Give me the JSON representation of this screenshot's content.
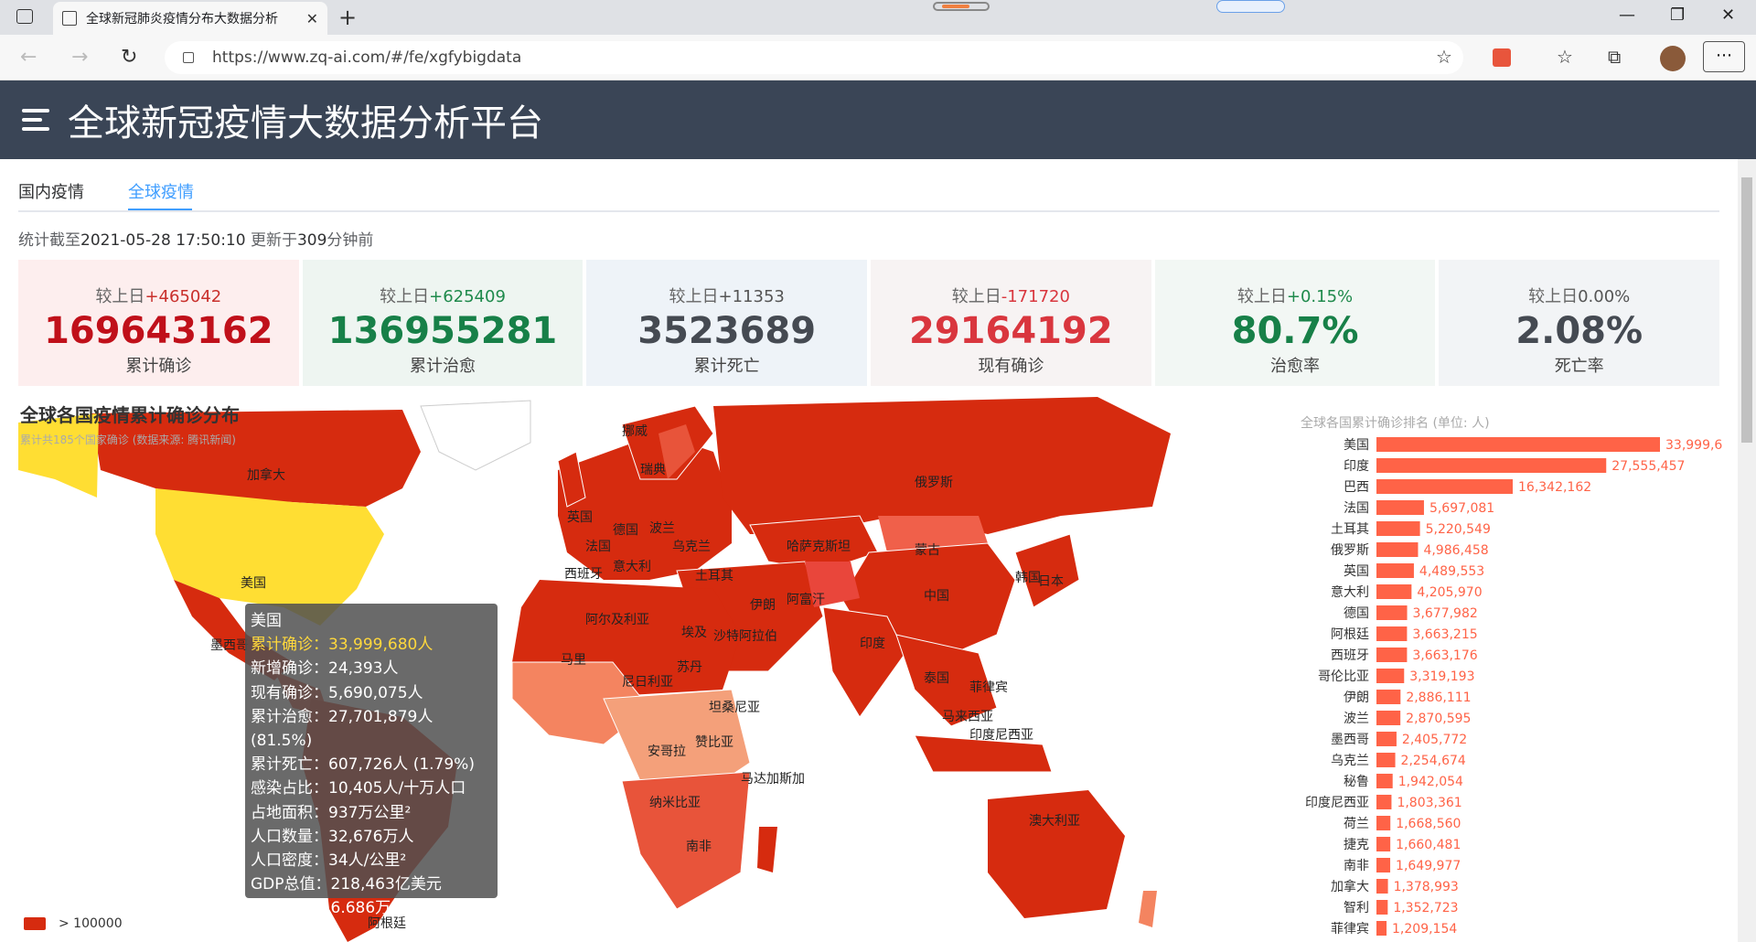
{
  "browser": {
    "tab_title": "全球新冠肺炎疫情分布大数据分析",
    "url": "https://www.zq-ai.com/#/fe/xgfybigdata"
  },
  "app": {
    "title": "全球新冠疫情大数据分析平台"
  },
  "tabs": [
    {
      "label": "国内疫情"
    },
    {
      "label": "全球疫情"
    }
  ],
  "stat_time": {
    "prefix": "统计截至",
    "time": "2021-05-28 17:50:10",
    "mid": " 更新于",
    "minutes": "309",
    "suffix": "分钟前"
  },
  "cards": [
    {
      "cmp_label": "较上日",
      "cmp_value": "+465042",
      "cmp_color": "#c9302c",
      "value": "169643162",
      "value_color": "#c0101a",
      "label": "累计确诊",
      "bg": "#fdeeee"
    },
    {
      "cmp_label": "较上日",
      "cmp_value": "+625409",
      "cmp_color": "#1f8a4c",
      "value": "136955281",
      "value_color": "#178048",
      "label": "累计治愈",
      "bg": "#eef5f1"
    },
    {
      "cmp_label": "较上日",
      "cmp_value": "+11353",
      "cmp_color": "#555",
      "value": "3523689",
      "value_color": "#454a52",
      "label": "累计死亡",
      "bg": "#eef3f8"
    },
    {
      "cmp_label": "较上日",
      "cmp_value": "-171720",
      "cmp_color": "#d9363e",
      "value": "29164192",
      "value_color": "#d9363e",
      "label": "现有确诊",
      "bg": "#f7f3f3"
    },
    {
      "cmp_label": "较上日",
      "cmp_value": "+0.15%",
      "cmp_color": "#1f8a4c",
      "value": "80.7%",
      "value_color": "#178048",
      "label": "治愈率",
      "bg": "#f2f7f4"
    },
    {
      "cmp_label": "较上日",
      "cmp_value": "0.00%",
      "cmp_color": "#555",
      "value": "2.08%",
      "value_color": "#454a52",
      "label": "死亡率",
      "bg": "#f2f4f6"
    }
  ],
  "map": {
    "title": "全球各国疫情累计确诊分布",
    "subtitle": "累计共185个国家确诊 (数据来源: 腾讯新闻)",
    "legend": "> 100000",
    "labels": [
      "加拿大",
      "美国",
      "墨西哥",
      "挪威",
      "瑞典",
      "俄罗斯",
      "英国",
      "德国",
      "波兰",
      "乌克兰",
      "法国",
      "意大利",
      "西班牙",
      "哈萨克斯坦",
      "蒙古",
      "土耳其",
      "伊朗",
      "阿富汗",
      "中国",
      "韩国",
      "日本",
      "阿尔及利亚",
      "埃及",
      "沙特阿拉伯",
      "印度",
      "马里",
      "苏丹",
      "尼日利亚",
      "泰国",
      "菲律宾",
      "马来西亚",
      "印度尼西亚",
      "坦桑尼亚",
      "安哥拉",
      "赞比亚",
      "马达加斯加",
      "纳米比亚",
      "南非",
      "澳大利亚",
      "阿根廷"
    ]
  },
  "tooltip": {
    "country": "美国",
    "rows": [
      {
        "k": "累计确诊",
        "v": "33,999,680人"
      },
      {
        "k": "新增确诊",
        "v": "24,393人"
      },
      {
        "k": "现有确诊",
        "v": "5,690,075人"
      },
      {
        "k": "累计治愈",
        "v": "27,701,879人 (81.5%)"
      },
      {
        "k": "累计死亡",
        "v": "607,726人 (1.79%)"
      },
      {
        "k": "感染占比",
        "v": "10,405人/十万人口"
      },
      {
        "k": "占地面积",
        "v": "937万公里²"
      },
      {
        "k": "人口数量",
        "v": "32,676万人"
      },
      {
        "k": "人口密度",
        "v": "34人/公里²"
      },
      {
        "k": "GDP总值",
        "v": "218,463亿美元"
      },
      {
        "k": "人均GDP",
        "v": "6.686万美元"
      }
    ]
  },
  "chart_data": {
    "type": "bar",
    "title": "全球各国累计确诊排名 (单位: 人)",
    "categories": [
      "美国",
      "印度",
      "巴西",
      "法国",
      "土耳其",
      "俄罗斯",
      "英国",
      "意大利",
      "德国",
      "阿根廷",
      "西班牙",
      "哥伦比亚",
      "伊朗",
      "波兰",
      "墨西哥",
      "乌克兰",
      "秘鲁",
      "印度尼西亚",
      "荷兰",
      "捷克",
      "南非",
      "加拿大",
      "智利",
      "菲律宾"
    ],
    "values": [
      33999680,
      27555457,
      16342162,
      5697081,
      5220549,
      4986458,
      4489553,
      4205970,
      3677982,
      3663215,
      3663176,
      3319193,
      2886111,
      2870595,
      2405772,
      2254674,
      1942054,
      1803361,
      1668560,
      1660481,
      1649977,
      1378993,
      1352723,
      1209154
    ],
    "value_labels": [
      "33,999,6",
      "27,555,457",
      "16,342,162",
      "5,697,081",
      "5,220,549",
      "4,986,458",
      "4,489,553",
      "4,205,970",
      "3,677,982",
      "3,663,215",
      "3,663,176",
      "3,319,193",
      "2,886,111",
      "2,870,595",
      "2,405,772",
      "2,254,674",
      "1,942,054",
      "1,803,361",
      "1,668,560",
      "1,660,481",
      "1,649,977",
      "1,378,993",
      "1,352,723",
      "1,209,154"
    ],
    "bar_color": "#ff6347"
  }
}
